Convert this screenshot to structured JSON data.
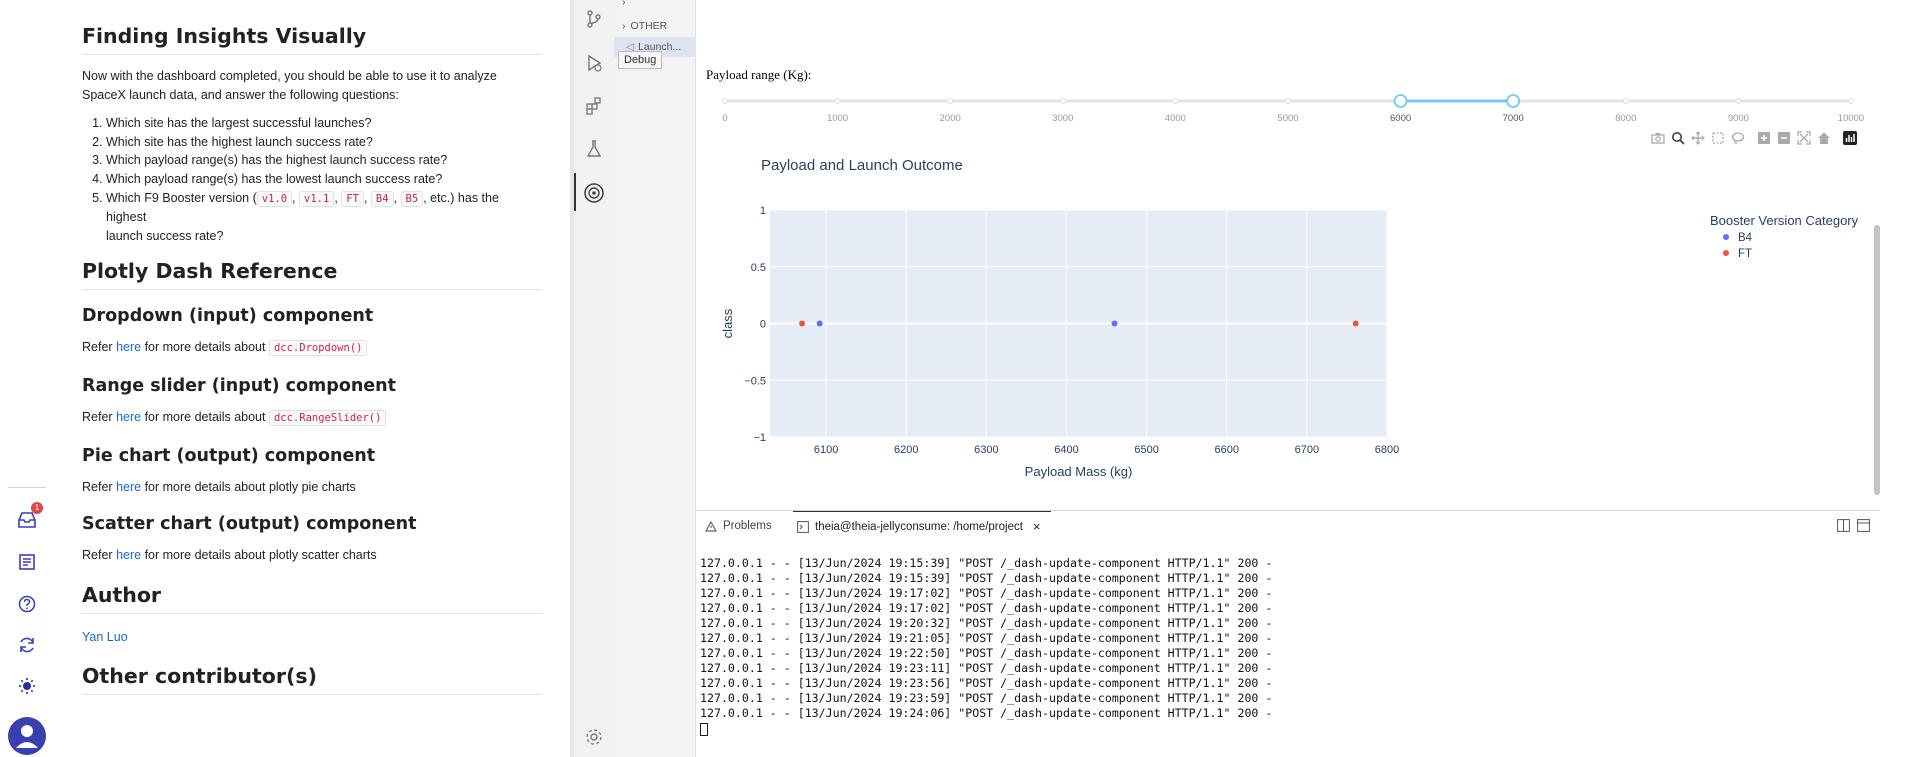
{
  "doc": {
    "title1": "Finding Insights Visually",
    "intro": "Now with the dashboard completed, you should be able to use it to analyze SpaceX launch data, and answer the following questions:",
    "questions": [
      "Which site has the largest successful launches?",
      "Which site has the highest launch success rate?",
      "Which payload range(s) has the highest launch success rate?",
      "Which payload range(s) has the lowest launch success rate?"
    ],
    "q5_prefix": "Which F9 Booster version (",
    "q5_codes": [
      "v1.0",
      "v1.1",
      "FT",
      "B4",
      "B5"
    ],
    "q5_sep": ",",
    "q5_suffix_line1": ", etc.) has the highest",
    "q5_suffix_line2": "launch success rate?",
    "title2": "Plotly Dash Reference",
    "sections": [
      {
        "heading": "Dropdown (input) component",
        "refer": "Refer",
        "link": "here",
        "after": "for more details about",
        "code": "dcc.Dropdown()"
      },
      {
        "heading": "Range slider (input) component",
        "refer": "Refer",
        "link": "here",
        "after": "for more details about",
        "code": "dcc.RangeSlider()"
      },
      {
        "heading": "Pie chart (output) component",
        "refer": "Refer",
        "link": "here",
        "after": "for more details about plotly pie charts",
        "code": ""
      },
      {
        "heading": "Scatter chart (output) component",
        "refer": "Refer",
        "link": "here",
        "after": "for more details about plotly scatter charts",
        "code": ""
      }
    ],
    "author_title": "Author",
    "author_name": "Yan Luo",
    "contrib_title": "Other contributor(s)"
  },
  "rail": {
    "badge_count": "1",
    "icons": [
      "inbox-icon",
      "notes-icon",
      "help-icon",
      "refresh-icon",
      "theme-icon",
      "avatar-icon"
    ]
  },
  "explorer": {
    "other_label": "OTHER",
    "launch_label": "Launch...",
    "debug_tooltip": "Debug"
  },
  "slider": {
    "label": "Payload range (Kg):",
    "min": 0,
    "max": 10000,
    "ticks": [
      0,
      1000,
      2000,
      3000,
      4000,
      5000,
      6000,
      7000,
      8000,
      9000,
      10000
    ],
    "selected_low": 6000,
    "selected_high": 7000
  },
  "chart_data": {
    "type": "scatter",
    "title": "Payload and Launch Outcome",
    "xlabel": "Payload Mass (kg)",
    "ylabel": "class",
    "xlim": [
      6030,
      6800
    ],
    "ylim": [
      -1,
      1
    ],
    "xticks": [
      6100,
      6200,
      6300,
      6400,
      6500,
      6600,
      6700,
      6800
    ],
    "yticks": [
      1,
      0.5,
      0,
      -0.5,
      -1
    ],
    "ytick_labels": [
      "1",
      "0.5",
      "0",
      "−0.5",
      "−1"
    ],
    "legend_title": "Booster Version Category",
    "legend_position": "top-right",
    "series": [
      {
        "name": "B4",
        "color": "#636efa",
        "points": [
          {
            "x": 6092,
            "y": 0
          },
          {
            "x": 6460,
            "y": 0
          }
        ]
      },
      {
        "name": "FT",
        "color": "#ef553b",
        "points": [
          {
            "x": 6070,
            "y": 0
          },
          {
            "x": 6761,
            "y": 0
          }
        ]
      }
    ]
  },
  "panel": {
    "problems_label": "Problems",
    "terminal_label": "theia@theia-jellyconsume: /home/project",
    "log_lines": [
      "127.0.0.1 - - [13/Jun/2024 19:15:39] \"POST /_dash-update-component HTTP/1.1\" 200 -",
      "127.0.0.1 - - [13/Jun/2024 19:15:39] \"POST /_dash-update-component HTTP/1.1\" 200 -",
      "127.0.0.1 - - [13/Jun/2024 19:17:02] \"POST /_dash-update-component HTTP/1.1\" 200 -",
      "127.0.0.1 - - [13/Jun/2024 19:17:02] \"POST /_dash-update-component HTTP/1.1\" 200 -",
      "127.0.0.1 - - [13/Jun/2024 19:20:32] \"POST /_dash-update-component HTTP/1.1\" 200 -",
      "127.0.0.1 - - [13/Jun/2024 19:21:05] \"POST /_dash-update-component HTTP/1.1\" 200 -",
      "127.0.0.1 - - [13/Jun/2024 19:22:50] \"POST /_dash-update-component HTTP/1.1\" 200 -",
      "127.0.0.1 - - [13/Jun/2024 19:23:11] \"POST /_dash-update-component HTTP/1.1\" 200 -",
      "127.0.0.1 - - [13/Jun/2024 19:23:56] \"POST /_dash-update-component HTTP/1.1\" 200 -",
      "127.0.0.1 - - [13/Jun/2024 19:23:59] \"POST /_dash-update-component HTTP/1.1\" 200 -",
      "127.0.0.1 - - [13/Jun/2024 19:24:06] \"POST /_dash-update-component HTTP/1.1\" 200 -"
    ]
  },
  "colors": {
    "accent_link": "#1b6ac9",
    "slider_active": "#7ac7ef",
    "plot_bg": "#e5ecf6",
    "badge": "#e0464b"
  }
}
